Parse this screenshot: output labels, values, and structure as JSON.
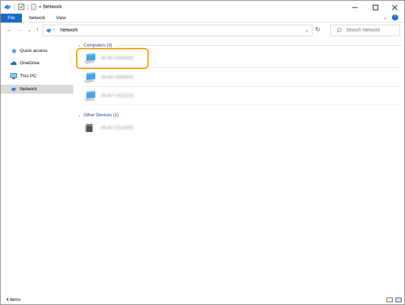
{
  "window": {
    "title": "Network",
    "minimize_icon": "minimize-icon",
    "maximize_icon": "maximize-icon",
    "close_icon": "close-icon"
  },
  "ribbon": {
    "tabs": [
      {
        "label": "File"
      },
      {
        "label": "Network"
      },
      {
        "label": "View"
      }
    ]
  },
  "address": {
    "path": "Network"
  },
  "search": {
    "placeholder": "Search Network"
  },
  "sidebar": {
    "items": [
      {
        "label": "Quick access",
        "icon": "star-icon"
      },
      {
        "label": "OneDrive",
        "icon": "cloud-icon"
      },
      {
        "label": "This PC",
        "icon": "computer-icon"
      },
      {
        "label": "Network",
        "icon": "network-icon",
        "selected": true
      }
    ]
  },
  "groups": {
    "computers": {
      "label": "Computers (3)",
      "items": [
        {
          "name": "46-60-1509003"
        },
        {
          "name": "46-60-1606006"
        },
        {
          "name": "46-62-1402226"
        }
      ]
    },
    "other_devices": {
      "label": "Other Devices (1)",
      "items": [
        {
          "name": "46-60-1510005"
        }
      ]
    }
  },
  "status": {
    "item_count": "4 items"
  },
  "colors": {
    "accent": "#1a6bc5",
    "highlight": "#f5a21b",
    "group_header": "#1e3287"
  }
}
